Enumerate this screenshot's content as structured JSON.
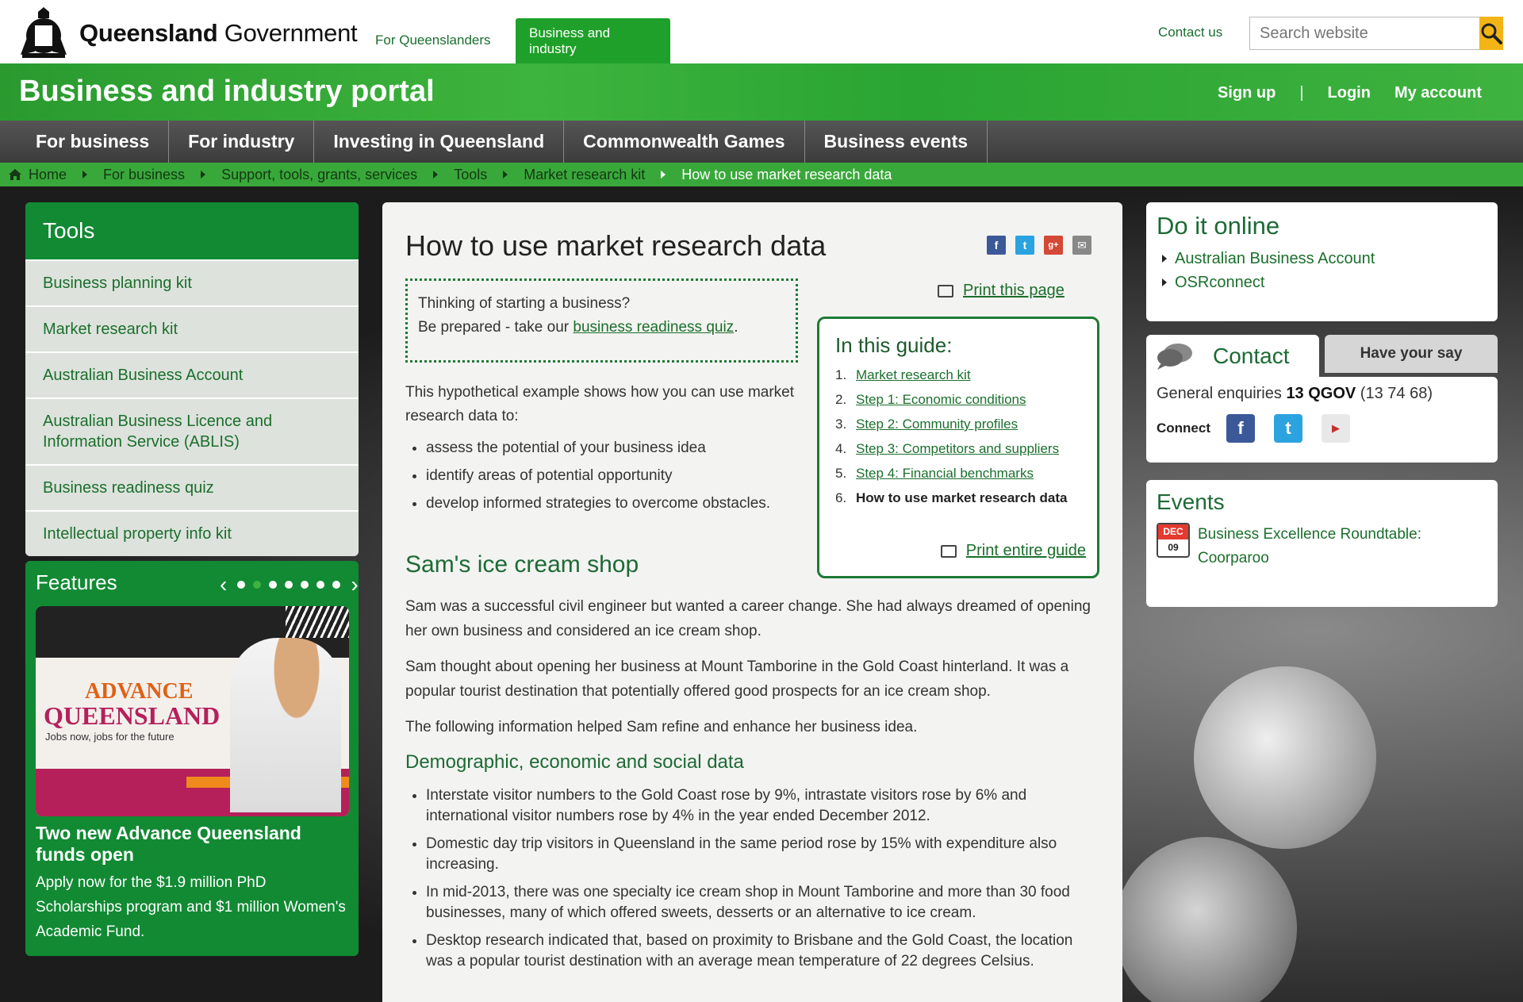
{
  "header": {
    "logo_text_bold": "Queensland",
    "logo_text_regular": "Government",
    "tabs": [
      {
        "label": "For Queenslanders"
      },
      {
        "label": "Business and industry"
      }
    ],
    "contact_label": "Contact us",
    "search": {
      "placeholder": "Search website"
    }
  },
  "portal": {
    "title": "Business and industry portal",
    "links": {
      "signup": "Sign up",
      "separator": "|",
      "login": "Login",
      "account": "My account"
    }
  },
  "main_nav": [
    {
      "label": "For business"
    },
    {
      "label": "For industry"
    },
    {
      "label": "Investing in Queensland"
    },
    {
      "label": "Commonwealth Games"
    },
    {
      "label": "Business events"
    }
  ],
  "breadcrumb": [
    {
      "label": "Home"
    },
    {
      "label": "For business"
    },
    {
      "label": "Support, tools, grants, services"
    },
    {
      "label": "Tools"
    },
    {
      "label": "Market research kit"
    },
    {
      "label": "How to use market research data"
    }
  ],
  "tools": {
    "title": "Tools",
    "items": [
      {
        "label": "Business planning kit"
      },
      {
        "label": "Market research kit"
      },
      {
        "label": "Australian Business Account"
      },
      {
        "label": "Australian Business Licence and Information Service (ABLIS)"
      },
      {
        "label": "Business readiness quiz"
      },
      {
        "label": "Intellectual property info kit"
      }
    ]
  },
  "features": {
    "title": "Features",
    "prev": "‹",
    "next": "›",
    "image_text": {
      "line1": "ADVANCE",
      "line2": "QUEENSLAND",
      "tagline": "Jobs now, jobs for the future"
    },
    "headline": "Two new Advance Queensland funds open",
    "text": "Apply now for the $1.9 million PhD Scholarships program and $1 million Women's Academic Fund."
  },
  "article": {
    "title": "How to use market research data",
    "share": [
      "f",
      "t",
      "g+",
      "✉"
    ],
    "callout": {
      "line1": "Thinking of starting a business?",
      "line2_prefix": "Be prepared - take our ",
      "link": "business readiness quiz",
      "line2_suffix": "."
    },
    "print_page": "Print this page",
    "guide": {
      "title": "In this guide:",
      "items": [
        {
          "num": "1.",
          "label": "Market research kit"
        },
        {
          "num": "2.",
          "label": "Step 1: Economic conditions"
        },
        {
          "num": "3.",
          "label": "Step 2: Community profiles"
        },
        {
          "num": "4.",
          "label": "Step 3: Competitors and suppliers"
        },
        {
          "num": "5.",
          "label": "Step 4: Financial benchmarks"
        },
        {
          "num": "6.",
          "label": "How to use market research data"
        }
      ],
      "print_guide": "Print entire guide"
    },
    "intro": "This hypothetical example shows how you can use market research data to:",
    "bullets": [
      "assess the potential of your business idea",
      "identify areas of potential opportunity",
      "develop informed strategies to overcome obstacles."
    ],
    "h2": "Sam's ice cream shop",
    "p1": "Sam was a successful civil engineer but wanted a career change. She had always dreamed of opening her own business and considered an ice cream shop.",
    "p2": "Sam thought about opening her business at Mount Tamborine in the Gold Coast hinterland. It was a popular tourist destination that potentially offered good prospects for an ice cream shop.",
    "p3": "The following information helped Sam refine and enhance her business idea.",
    "h3": "Demographic, economic and social data",
    "demo": [
      "Interstate visitor numbers to the Gold Coast rose by 9%, intrastate visitors rose by 6% and international visitor numbers rose by 4% in the year ended December 2012.",
      "Domestic day trip visitors in Queensland in the same period rose by 15% with expenditure also increasing.",
      "In mid-2013, there was one specialty ice cream shop in Mount Tamborine and more than 30 food businesses, many of which offered sweets,  desserts or an alternative to ice cream.",
      "Desktop research indicated that, based on proximity to Brisbane and the Gold Coast, the location was a popular tourist destination with an average mean temperature of 22 degrees Celsius."
    ]
  },
  "do_online": {
    "title": "Do it online",
    "links": [
      {
        "label": "Australian Business Account"
      },
      {
        "label": "OSRconnect"
      }
    ]
  },
  "contact": {
    "tab": "Contact",
    "other_tab": "Have your say",
    "enquiries_label": "General enquiries ",
    "enquiries_bold": "13 QGOV",
    "enquiries_num": " (13 74 68)",
    "connect_label": "Connect"
  },
  "events": {
    "title": "Events",
    "items": [
      {
        "month": "DEC",
        "day": "09",
        "title": "Business Excellence Roundtable: Coorparoo"
      }
    ]
  },
  "colors": {
    "brand_green": "#1fa02a",
    "dark_green": "#118a33",
    "search_button": "#f3b416"
  }
}
